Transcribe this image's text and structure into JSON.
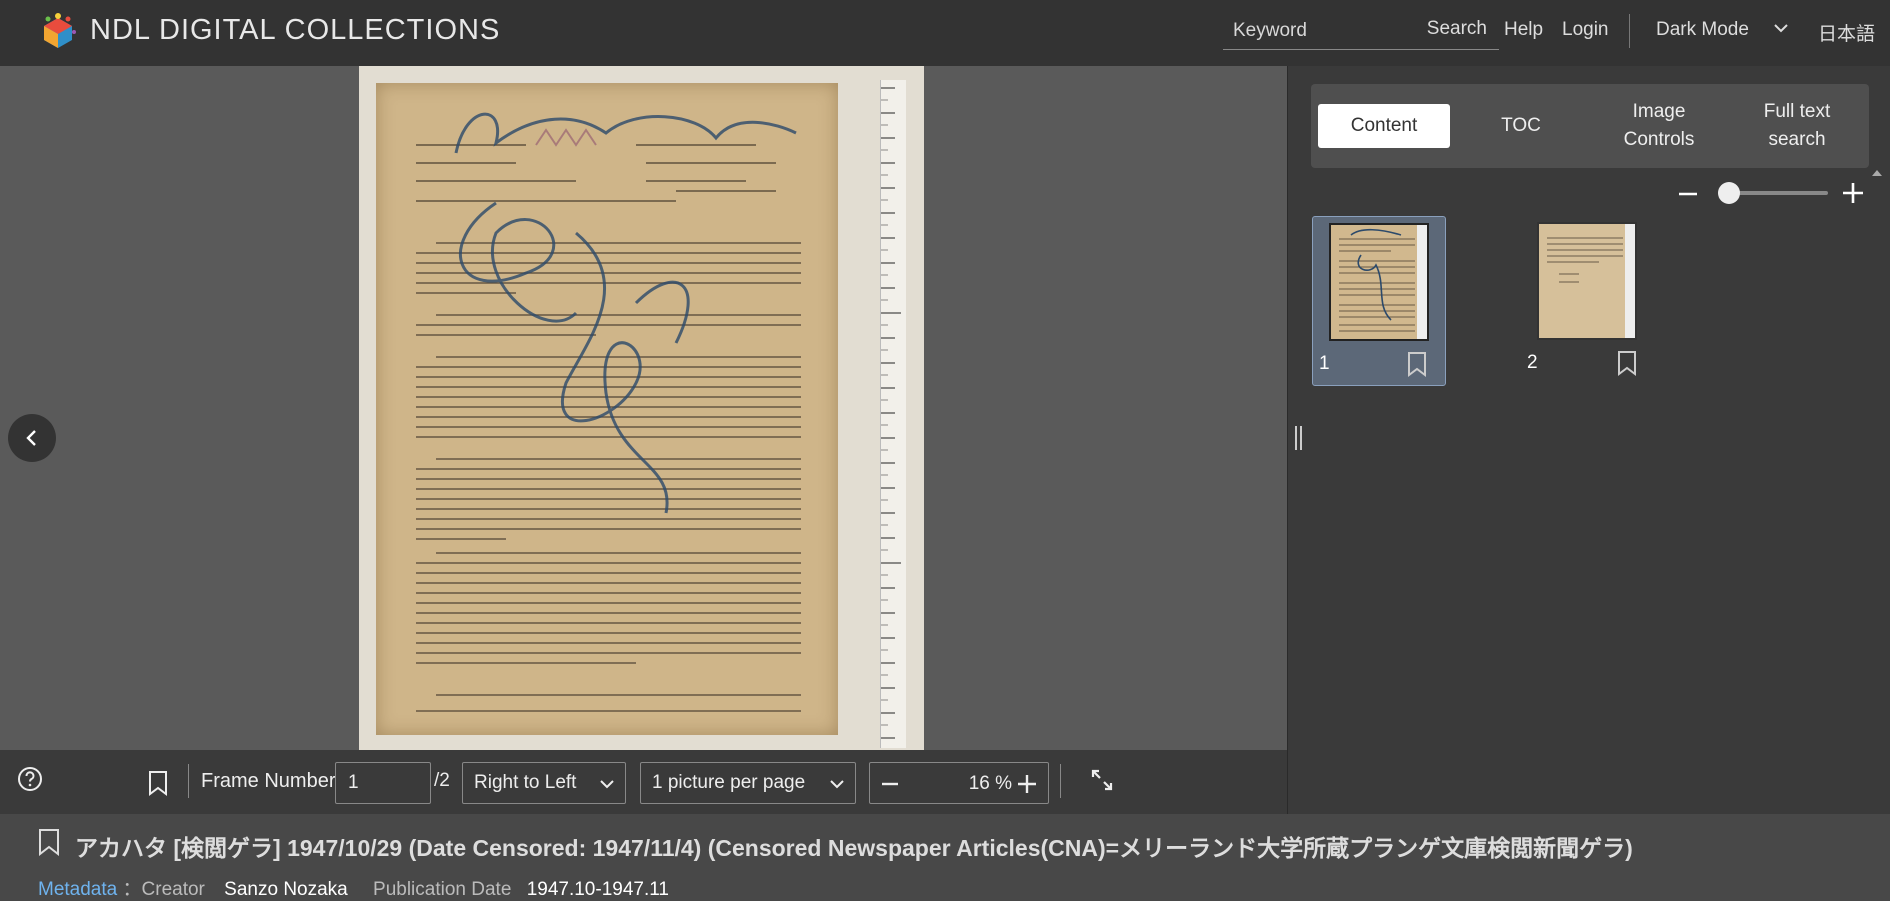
{
  "header": {
    "brand": "NDL DIGITAL COLLECTIONS",
    "search_placeholder": "Keyword",
    "search_label": "Search",
    "help_label": "Help",
    "login_label": "Login",
    "dark_mode_label": "Dark Mode",
    "language_label": "日本語"
  },
  "toolbar": {
    "frame_label": "Frame Number",
    "frame_value": "1",
    "frame_total": "/2",
    "direction": "Right to Left",
    "layout": "1 picture per page",
    "zoom": "16 %"
  },
  "panel": {
    "tabs": [
      {
        "label": "Content"
      },
      {
        "label": "TOC"
      },
      {
        "label": "Image\nControls"
      },
      {
        "label": "Full text\nsearch"
      }
    ],
    "thumb_zoom": 0.1,
    "thumbnails": [
      {
        "label": "1",
        "selected": true
      },
      {
        "label": "2",
        "selected": false
      }
    ]
  },
  "document": {
    "title": "アカハタ [検閲ゲラ] 1947/10/29 (Date Censored: 1947/11/4) (Censored Newspaper Articles(CNA)=メリーランド大学所蔵プランゲ文庫検閲新聞ゲラ)",
    "metadata_link": "Metadata",
    "creator_key": "Creator",
    "creator_value": "Sanzo Nozaka",
    "pubdate_key": "Publication Date",
    "pubdate_value": "1947.10-1947.11"
  },
  "colors": {
    "header_bg": "#333333",
    "viewer_bg": "#5a5a5a",
    "link": "#6fb3ee",
    "selected_thumb": "#5c6878"
  }
}
